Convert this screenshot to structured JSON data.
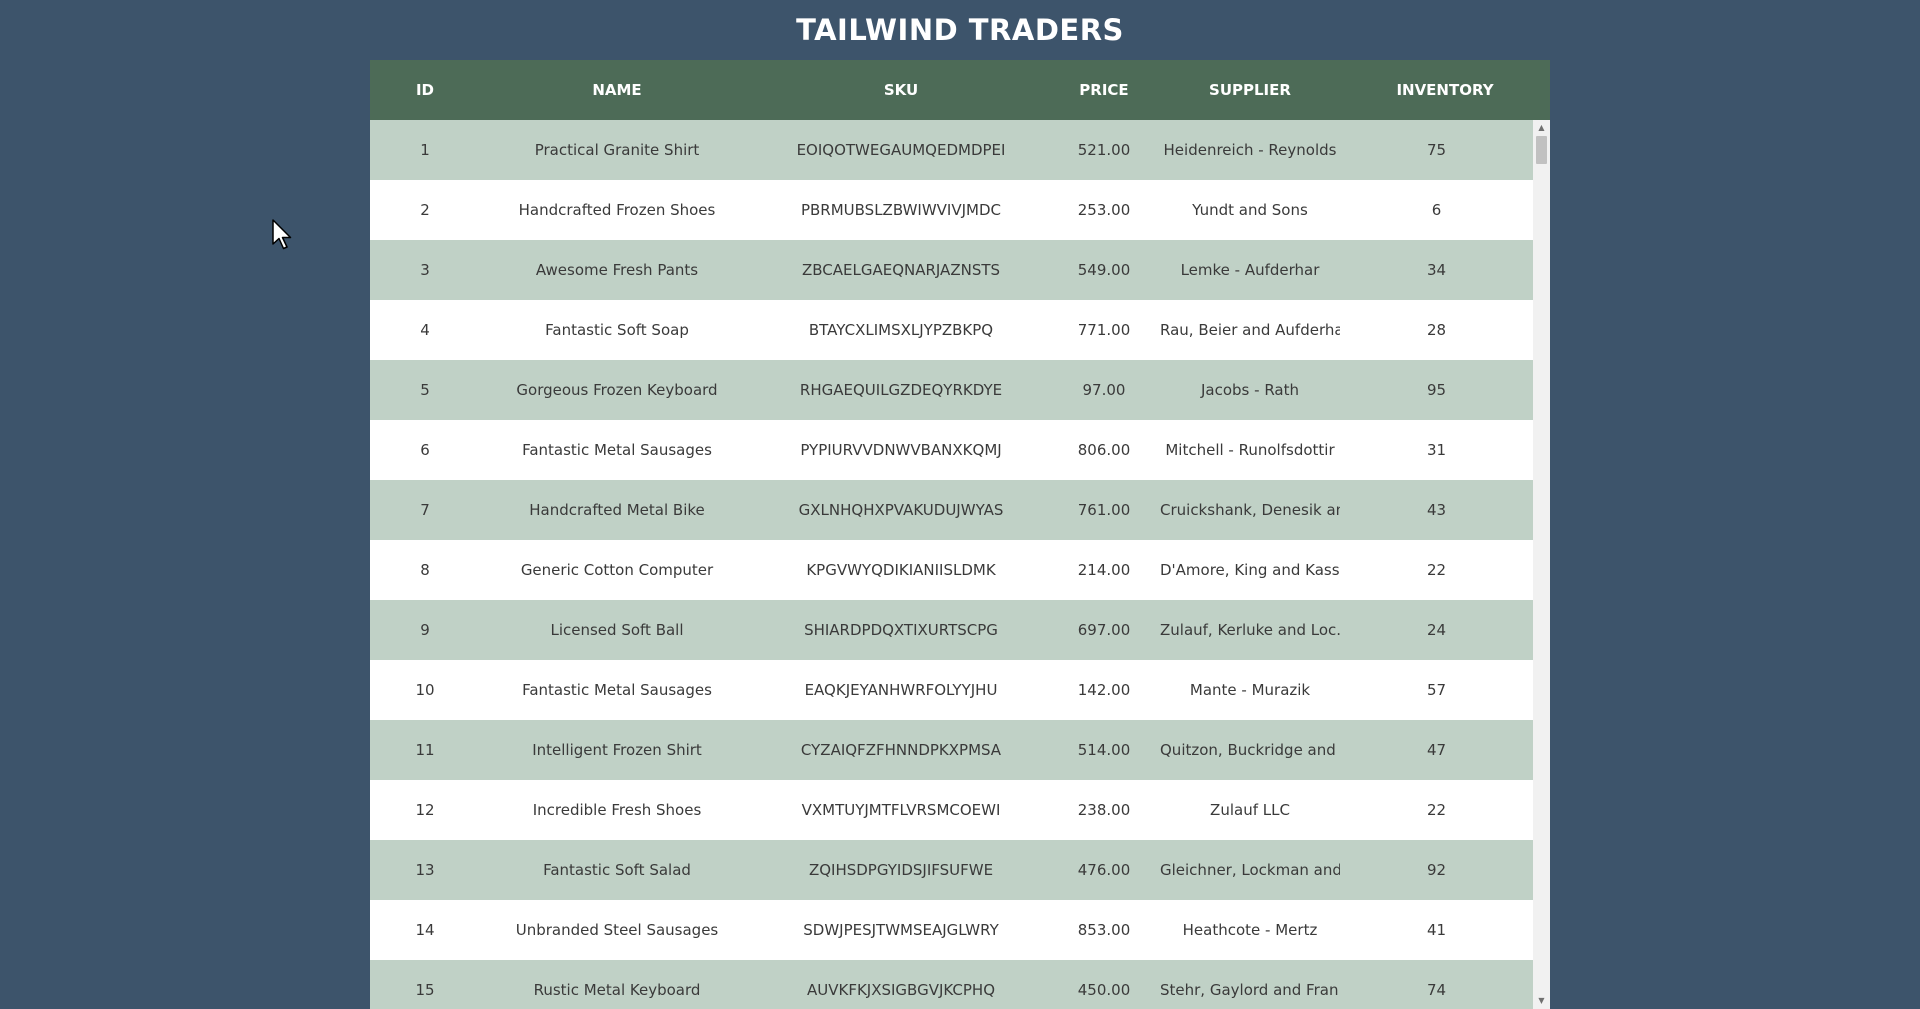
{
  "page": {
    "title": "TAILWIND TRADERS"
  },
  "table": {
    "columns": {
      "id": "ID",
      "name": "NAME",
      "sku": "SKU",
      "price": "PRICE",
      "supplier": "SUPPLIER",
      "inventory": "INVENTORY"
    },
    "rows": [
      {
        "id": "1",
        "name": "Practical Granite Shirt",
        "sku": "EOIQOTWEGAUMQEDMDPEI",
        "price": "521.00",
        "supplier": "Heidenreich - Reynolds",
        "inventory": "75"
      },
      {
        "id": "2",
        "name": "Handcrafted Frozen Shoes",
        "sku": "PBRMUBSLZBWIWVIVJMDC",
        "price": "253.00",
        "supplier": "Yundt and Sons",
        "inventory": "6"
      },
      {
        "id": "3",
        "name": "Awesome Fresh Pants",
        "sku": "ZBCAELGAEQNARJAZNSTS",
        "price": "549.00",
        "supplier": "Lemke - Aufderhar",
        "inventory": "34"
      },
      {
        "id": "4",
        "name": "Fantastic Soft Soap",
        "sku": "BTAYCXLIMSXLJYPZBKPQ",
        "price": "771.00",
        "supplier": "Rau, Beier and Aufderhar",
        "inventory": "28"
      },
      {
        "id": "5",
        "name": "Gorgeous Frozen Keyboard",
        "sku": "RHGAEQUILGZDEQYRKDYE",
        "price": "97.00",
        "supplier": "Jacobs - Rath",
        "inventory": "95"
      },
      {
        "id": "6",
        "name": "Fantastic Metal Sausages",
        "sku": "PYPIURVVDNWVBANXKQMJ",
        "price": "806.00",
        "supplier": "Mitchell - Runolfsdottir",
        "inventory": "31"
      },
      {
        "id": "7",
        "name": "Handcrafted Metal Bike",
        "sku": "GXLNHQHXPVAKUDUJWYAS",
        "price": "761.00",
        "supplier": "Cruickshank, Denesik an...",
        "inventory": "43"
      },
      {
        "id": "8",
        "name": "Generic Cotton Computer",
        "sku": "KPGVWYQDIKIANIISLDMK",
        "price": "214.00",
        "supplier": "D'Amore, King and Kass...",
        "inventory": "22"
      },
      {
        "id": "9",
        "name": "Licensed Soft Ball",
        "sku": "SHIARDPDQXTIXURTSCPG",
        "price": "697.00",
        "supplier": "Zulauf, Kerluke and Loc...",
        "inventory": "24"
      },
      {
        "id": "10",
        "name": "Fantastic Metal Sausages",
        "sku": "EAQKJEYANHWRFOLYYJHU",
        "price": "142.00",
        "supplier": "Mante - Murazik",
        "inventory": "57"
      },
      {
        "id": "11",
        "name": "Intelligent Frozen Shirt",
        "sku": "CYZAIQFZFHNNDPKXPMSA",
        "price": "514.00",
        "supplier": "Quitzon, Buckridge and ...",
        "inventory": "47"
      },
      {
        "id": "12",
        "name": "Incredible Fresh Shoes",
        "sku": "VXMTUYJMTFLVRSMCOEWI",
        "price": "238.00",
        "supplier": "Zulauf LLC",
        "inventory": "22"
      },
      {
        "id": "13",
        "name": "Fantastic Soft Salad",
        "sku": "ZQIHSDPGYIDSJIFSUFWE",
        "price": "476.00",
        "supplier": "Gleichner, Lockman and...",
        "inventory": "92"
      },
      {
        "id": "14",
        "name": "Unbranded Steel Sausages",
        "sku": "SDWJPESJTWMSEAJGLWRY",
        "price": "853.00",
        "supplier": "Heathcote - Mertz",
        "inventory": "41"
      },
      {
        "id": "15",
        "name": "Rustic Metal Keyboard",
        "sku": "AUVKFKJXSIGBGVJKCPHQ",
        "price": "450.00",
        "supplier": "Stehr, Gaylord and Fran...",
        "inventory": "74"
      }
    ]
  },
  "scrollbar": {
    "up_icon": "triangle-up",
    "down_icon": "triangle-down"
  },
  "cursor": {
    "icon": "mouse-pointer-arrow"
  },
  "colors": {
    "background": "#3d546b",
    "header": "#4d6b57",
    "row_alt": "#c0d1c6",
    "row": "#ffffff"
  }
}
